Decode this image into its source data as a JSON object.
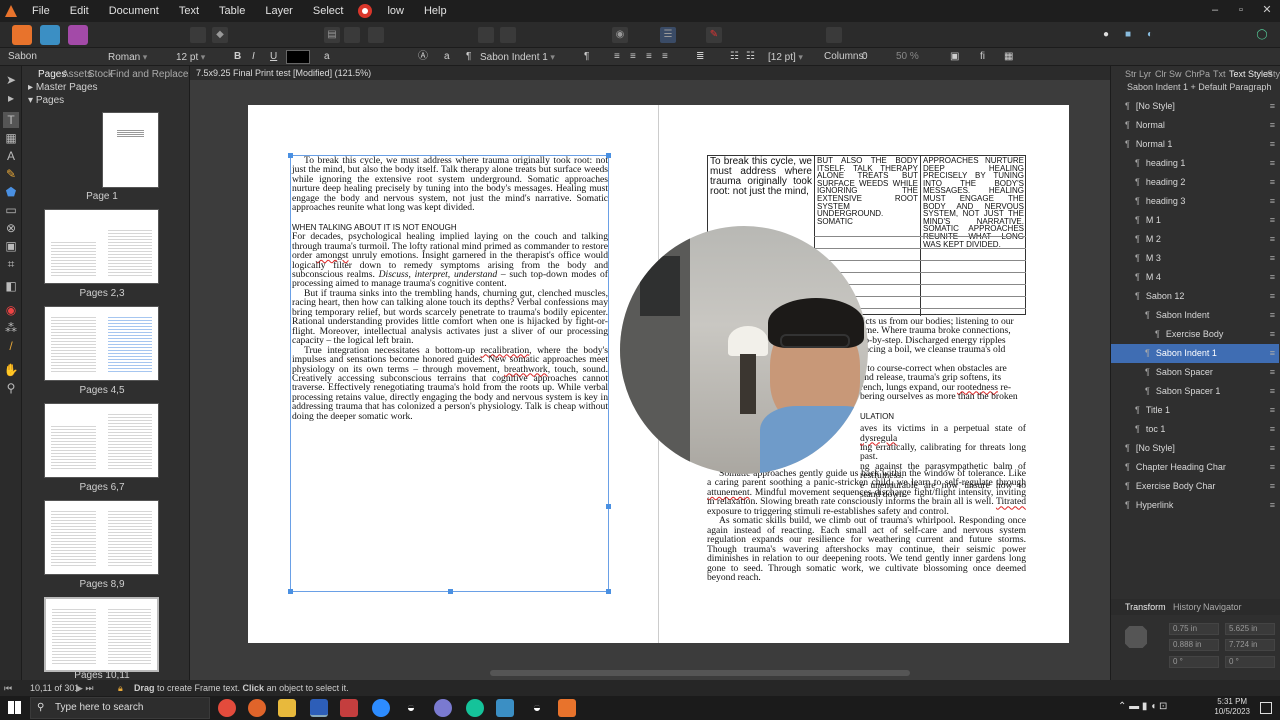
{
  "menu": [
    "File",
    "Edit",
    "Document",
    "Text",
    "Table",
    "Layer",
    "Select",
    "low",
    "Help"
  ],
  "context_bar": {
    "style_name": "Sabon",
    "font_style": "Roman",
    "font_size": "12 pt",
    "paragraph_style": "Sabon Indent 1",
    "leading": "[12 pt]",
    "columns_label": "Columns:",
    "columns_value": "0",
    "zoom": "50 %"
  },
  "pages_panel": {
    "tabs": [
      "Pages",
      "Assets",
      "Stock",
      "Find and Replace"
    ],
    "master_pages": "Master Pages",
    "pages": "Pages",
    "thumbnails": [
      "Page 1",
      "Pages 2,3",
      "Pages 4,5",
      "Pages 6,7",
      "Pages 8,9",
      "Pages 10,11"
    ]
  },
  "document": {
    "tab_title": "7.5x9.25 Final Print test [Modified] (121.5%)",
    "left_page": {
      "para1": "To break this cycle, we must address where trauma originally took root: not just the mind, but also the body itself. Talk therapy alone treats but surface weeds while ignoring the extensive root system underground. Somatic approaches nurture deep healing precisely by tuning into the body's messages. Healing must engage the body and nervous system, not just the mind's narrative. Somatic approaches reunite what long was kept divided.",
      "heading": "WHEN TALKING ABOUT IT IS NOT ENOUGH",
      "para2a": "For decades, psychological healing implied laying on the couch and talking through trauma's turmoil. The lofty rational mind primed as commander to restore order ",
      "para2_ul": "amongst",
      "para2b": " unruly emotions. Insight garnered in the therapist's office would logically filter down to remedy symptoms arising from the body and subconscious realms. ",
      "para2_it": "Discuss, interpret, understand",
      "para2c": " – such top-down modes of processing aimed to manage trauma's cognitive content.",
      "para3": "But if trauma sinks into the trembling hands, churning gut, clenched muscles, racing heart, then how can talking alone touch its depths? Verbal confessions may bring temporary relief, but words scarcely penetrate to trauma's bodily epicenter. Rational understanding provides little comfort when one is hijacked by fight-or-flight. Moreover, intellectual analysis activates just a sliver of our processing capacity – the logical left brain.",
      "para4a": "True integration necessitates a bottom-up ",
      "para4_ul1": "recalibration",
      "para4b": ", where the body's impulses and sensations become honored guides. New somatic approaches meet physiology on its own terms – through movement, ",
      "para4_ul2": "breathwork",
      "para4c": ", touch, sound. Creatively accessing subconscious terrains that cognitive approaches cannot traverse. Effectively renegotiating trauma's hold from the roots up. While verbal processing retains value, directly engaging the body and nervous system is key in addressing trauma that has colonized a person's physiology. Talk is cheap without doing the deeper somatic work."
    },
    "right_page": {
      "table_col1": "To break this cycle, we must address where trauma originally took root: not just the mind,",
      "table_col2": "BUT ALSO THE BODY ITSELF. TALK THERAPY ALONE TREATS BUT SURFACE WEEDS WHILE IGNORING THE EXTENSIVE ROOT SYSTEM UNDERGROUND. SOMATIC",
      "table_col3": "APPROACHES NURTURE DEEP HEALING PRECISELY BY TUNING INTO THE BODY'S MESSAGES. HEALING MUST ENGAGE THE BODY AND NERVOUS SYSTEM, NOT JUST THE MIND'S NARRATIVE. SOMATIC APPROACHES REUNITE WHAT LONG WAS KEPT DIVIDED.",
      "frag1": "licts us from our bodies; listening to our",
      "frag2": "ome. Where trauma broke connections,",
      "frag3": "ep-by-step. Discharged energy ripples",
      "frag4": "ancing a boil, we cleanse trauma's old",
      "frag5": "n to course-correct when obstacles are",
      "frag6": "and release, trauma's grip softens, its",
      "frag7a": "rench, lungs expand, our ",
      "frag7_ul": "rootedness",
      "frag7b": " re-",
      "frag8": "bering ourselves as more than the broken",
      "frag_heading": "ULATION",
      "frag9a": "aves its victims in a perpetual state of ",
      "frag9_ul": "dysregula",
      "frag10": "ing erratically, calibrating for threats long past.",
      "frag11": "ng against the parasympathetic balm of restfulness.",
      "frag12": "e unendurable are now unsure how to stand down.",
      "para_b1": "Somatic approaches gently guide us back within the window of tolerance. Like a caring parent soothing a panic-stricken child, we learn to self-regulate through ",
      "para_b1_ul": "attunement",
      "para_b1b": ". Mindful movement sequences discharge fight/flight intensity, inviting in relaxation. Slowing breath rate consciously informs the brain all is well. ",
      "para_b1_ul2": "Titrated",
      "para_b1c": " exposure to triggering stimuli re-establishes safety and control.",
      "para_b2": "As somatic skills build, we climb out of trauma's whirlpool. Responding once again instead of reacting. Each small act of self-care and nervous system regulation expands our resilience for weathering current and future storms. Though trauma's wavering aftershocks may continue, their seismic power diminishes in relation to our deepening roots. We tend gently inner gardens long gone to seed. Through somatic work, we cultivate blossoming once deemed beyond reach."
    }
  },
  "right_panel": {
    "tabs": [
      "Str",
      "Lyr",
      "Clr",
      "Sw",
      "Chr",
      "Pa",
      "Txt",
      "Text Styles",
      "Sty"
    ],
    "header_style": "Sabon Indent 1 + Default Paragraph",
    "styles": [
      {
        "label": "[No Style]",
        "indent": 0,
        "selected": false
      },
      {
        "label": "Normal",
        "indent": 0,
        "selected": false
      },
      {
        "label": "Normal 1",
        "indent": 0,
        "selected": false
      },
      {
        "label": "heading 1",
        "indent": 1,
        "selected": false
      },
      {
        "label": "heading 2",
        "indent": 1,
        "selected": false
      },
      {
        "label": "heading 3",
        "indent": 1,
        "selected": false
      },
      {
        "label": "M 1",
        "indent": 1,
        "selected": false
      },
      {
        "label": "M 2",
        "indent": 1,
        "selected": false
      },
      {
        "label": "M 3",
        "indent": 1,
        "selected": false
      },
      {
        "label": "M 4",
        "indent": 1,
        "selected": false
      },
      {
        "label": "Sabon 12",
        "indent": 1,
        "selected": false
      },
      {
        "label": "Sabon Indent",
        "indent": 2,
        "selected": false
      },
      {
        "label": "Exercise Body",
        "indent": 3,
        "selected": false
      },
      {
        "label": "Sabon Indent 1",
        "indent": 2,
        "selected": true
      },
      {
        "label": "Sabon Spacer",
        "indent": 2,
        "selected": false
      },
      {
        "label": "Sabon Spacer 1",
        "indent": 2,
        "selected": false
      },
      {
        "label": "Title 1",
        "indent": 1,
        "selected": false
      },
      {
        "label": "toc 1",
        "indent": 1,
        "selected": false
      },
      {
        "label": "[No Style]",
        "indent": 0,
        "selected": false
      },
      {
        "label": "Chapter Heading Char",
        "indent": 0,
        "selected": false
      },
      {
        "label": "Exercise Body Char",
        "indent": 0,
        "selected": false
      },
      {
        "label": "Hyperlink",
        "indent": 0,
        "selected": false
      }
    ],
    "transform_tabs": [
      "Transform",
      "History",
      "Navigator"
    ],
    "transform_fields": [
      "0.75 in",
      "5.625 in",
      "0.888 in",
      "7.724 in",
      "0 °",
      "0 °"
    ]
  },
  "status_bar": {
    "page_indicator": "10,11 of 301",
    "hint_drag": "Drag",
    "hint1": " to create Frame text. ",
    "hint_click": "Click",
    "hint2": " an object to select it."
  },
  "taskbar": {
    "search_placeholder": "Type here to search",
    "time": "5:31 PM",
    "date": "10/5/2023"
  },
  "colors": {
    "accent": "#3f6db3",
    "selection_frame": "#6aa0e6",
    "spellcheck": "#d22222"
  }
}
